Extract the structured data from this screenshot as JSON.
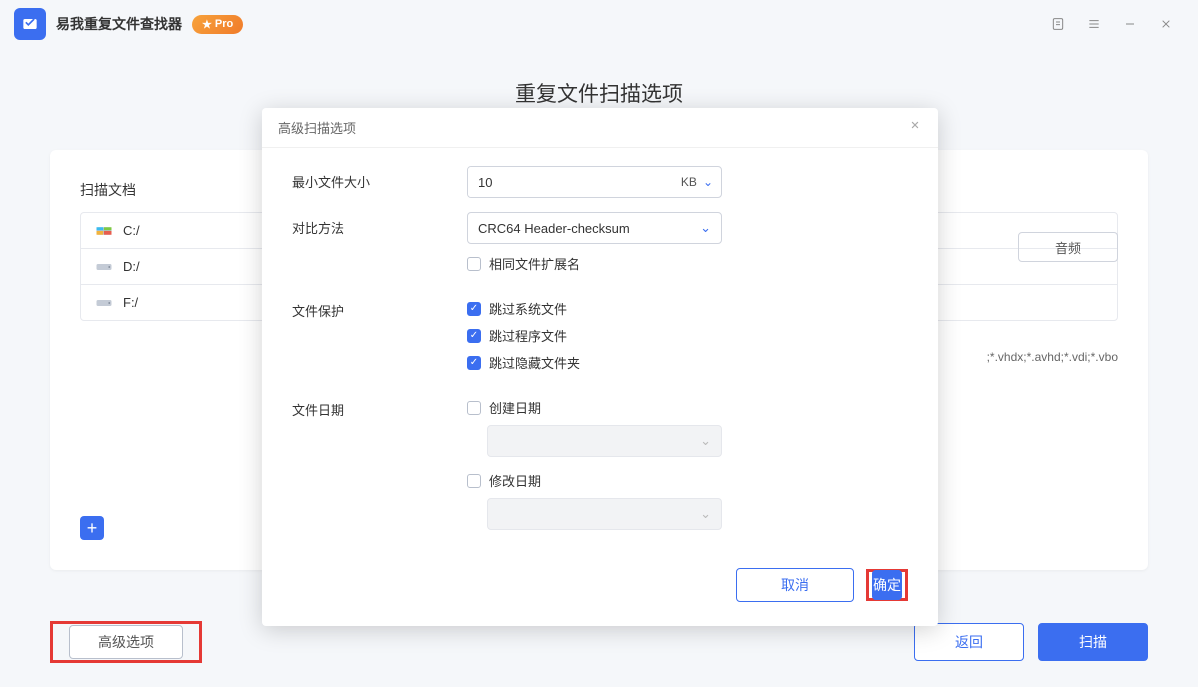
{
  "app": {
    "title": "易我重复文件查找器",
    "pro": "Pro"
  },
  "page": {
    "heading": "重复文件扫描选项",
    "scan_section": "扫描文档",
    "drives": [
      {
        "label": "C:/",
        "kind": "windows"
      },
      {
        "label": "D:/",
        "kind": "hdd"
      },
      {
        "label": "F:/",
        "kind": "hdd"
      }
    ],
    "type_button": "音频",
    "ext_hint": ";*.vhdx;*.avhd;*.vdi;*.vbo"
  },
  "buttons": {
    "advanced": "高级选项",
    "back": "返回",
    "scan": "扫描"
  },
  "dialog": {
    "title": "高级扫描选项",
    "min_size_label": "最小文件大小",
    "min_size_value": "10",
    "min_size_unit": "KB",
    "compare_label": "对比方法",
    "compare_value": "CRC64 Header-checksum",
    "same_ext": "相同文件扩展名",
    "protect_label": "文件保护",
    "skip_system": "跳过系统文件",
    "skip_program": "跳过程序文件",
    "skip_hidden": "跳过隐藏文件夹",
    "date_label": "文件日期",
    "create_date": "创建日期",
    "modify_date": "修改日期",
    "cancel": "取消",
    "ok": "确定"
  }
}
